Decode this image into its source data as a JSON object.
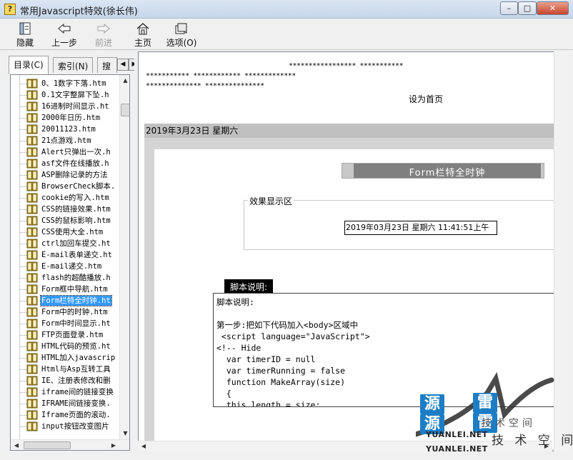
{
  "window": {
    "title": "常用Javascript特效(徐长伟)",
    "min_label": "0",
    "max_label": "1",
    "close_label": "r"
  },
  "toolbar": {
    "hide_label": "隐藏",
    "back_label": "上一步",
    "forward_label": "前进",
    "home_label": "主页",
    "options_label": "选项(O)"
  },
  "nav_tabs": {
    "contents_label": "目录(C)",
    "index_label": "索引(N)",
    "search_label": "搜"
  },
  "tree": {
    "items": [
      "0、1数字下落.htm",
      "0.1文字整屏下坠.h",
      "16进制时间显示.ht",
      "2000年日历.htm",
      "20011123.htm",
      "21点游戏.htm",
      "Alert只弹出一次.h",
      "asf文件在线播放.h",
      "ASP删除记录的方法",
      "BrowserCheck脚本.",
      "cookie的写入.htm",
      "CSS的链接效果.htm",
      "CSS的鼠标影响.htm",
      "CSS使用大全.htm",
      "ctrl加回车提交.ht",
      "E-mail表单递交.ht",
      "E-mail递交.htm",
      "flash的超酷播放.h",
      "Form框中导航.htm",
      "Form栏特全时钟.ht",
      "Form中的时钟.htm",
      "Form中时间显示.ht",
      "FTP页面登录.htm",
      "HTML代码的预览.ht",
      "HTML加入javascrip",
      "Html与Asp互转工具",
      "IE、注册表修改和删",
      "iframe间的链接变换",
      "IFRAME间链接变换.",
      "Iframe页面的滚动.",
      "input按钮改变图片"
    ],
    "selected_index": 19
  },
  "content": {
    "stars_line1": "***************** ***********",
    "stars_line2": "*********** ************ *************",
    "stars_line3": "************** ***************",
    "home_link": "设为首页",
    "date_bar": "2019年3月23日  星期六",
    "banner_title": "Form栏特全时钟",
    "legend": "效果显示区",
    "clock_value": "2019年03月23日  星期六  11:41:51上午",
    "script_tab": "脚本说明:",
    "code_lines": [
      "脚本说明:",
      "",
      "第一步:把如下代码加入<body>区域中",
      " <script language=\"JavaScript\">",
      "<!-- Hide",
      "  var timerID = null",
      "  var timerRunning = false",
      "  function MakeArray(size)",
      "  {",
      "  this.length = size;"
    ]
  },
  "watermark": {
    "tiles": [
      "源",
      "雷",
      "源",
      "雷"
    ],
    "site": "YUANLEI.NET",
    "site_bottom": "YUANLEI.NET",
    "cn_top": "技术空间",
    "cn_bottom": "技 术 空 间"
  },
  "colors": {
    "selection": "#3399ff",
    "watermark_blue": "#1d7dc4"
  }
}
